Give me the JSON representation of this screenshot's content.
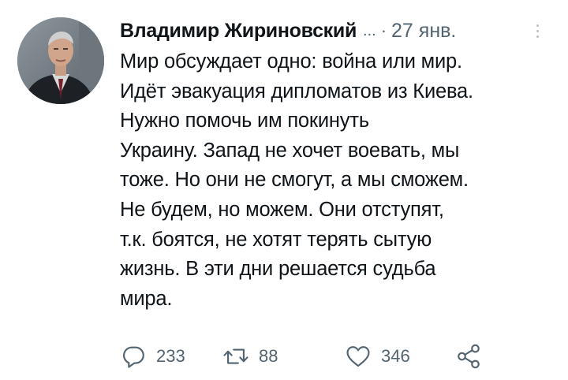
{
  "tweet": {
    "author_name": "Владимир Жириновский",
    "ellipsis": "...",
    "separator": "·",
    "date": "27 янв.",
    "avatar": "author-avatar-photo",
    "body_lines": [
      "Мир обсуждает одно: война или мир.",
      "Идёт эвакуация дипломатов из Киева.",
      "Нужно помочь им покинуть",
      "Украину. Запад не хочет воевать, мы",
      "тоже. Но они не смогут, а мы сможем.",
      "Не будем, но можем. Они отступят,",
      "т.к. боятся, не хотят терять сытую",
      "жизнь. В эти дни решается судьба",
      "мира."
    ],
    "actions": {
      "reply": {
        "icon": "reply-icon",
        "count": "233"
      },
      "retweet": {
        "icon": "retweet-icon",
        "count": "88"
      },
      "like": {
        "icon": "heart-icon",
        "count": "346"
      },
      "share": {
        "icon": "share-icon"
      }
    }
  },
  "colors": {
    "text": "#0f1419",
    "secondary": "#536471",
    "background": "#ffffff"
  }
}
